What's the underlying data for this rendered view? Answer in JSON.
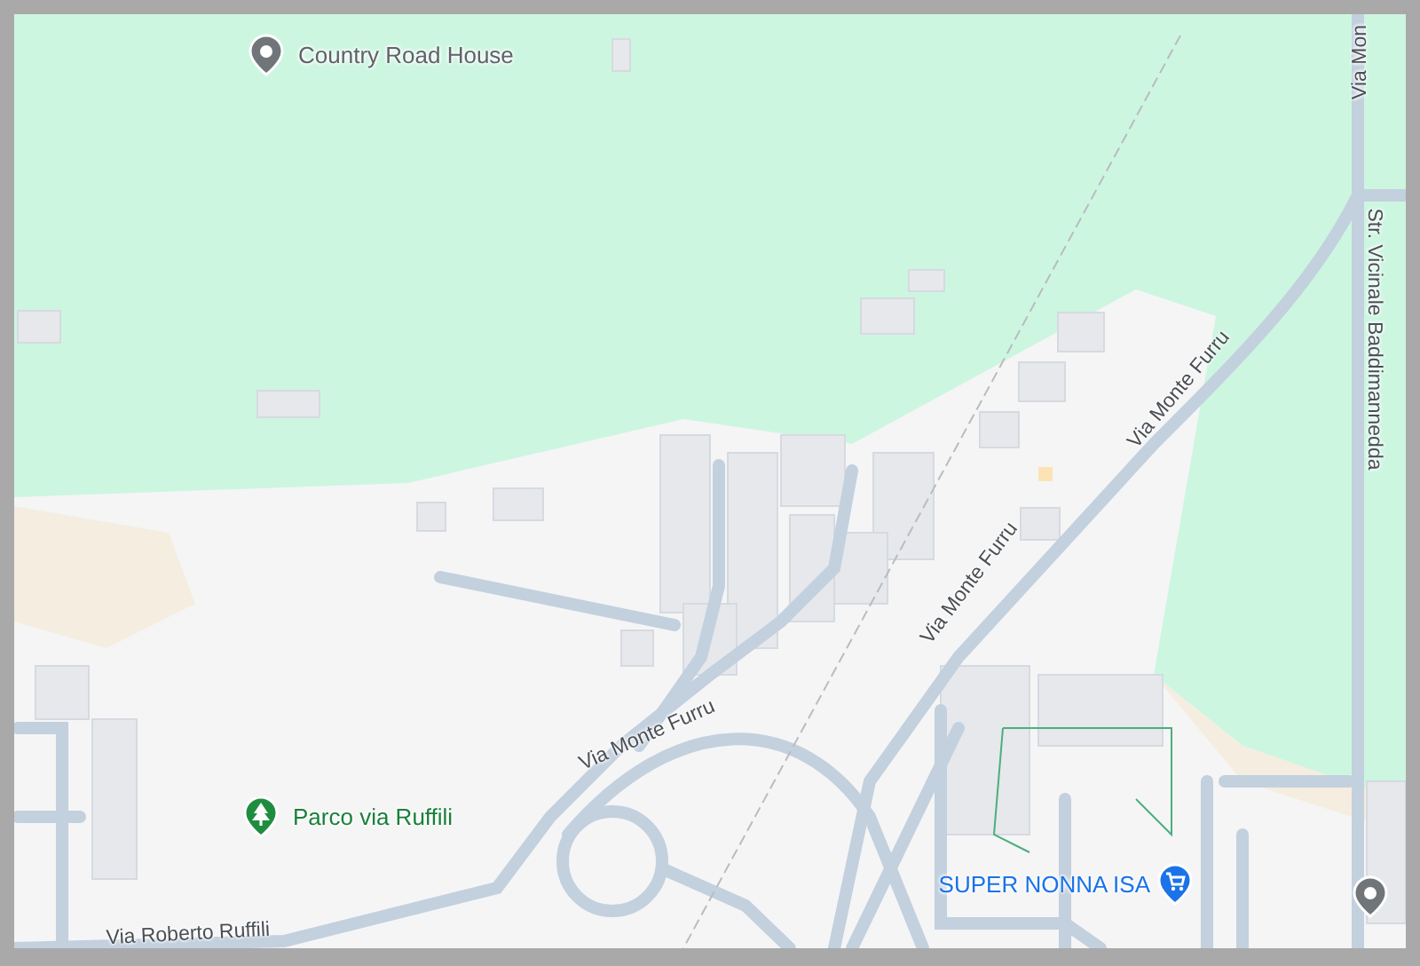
{
  "map": {
    "places": [
      {
        "name": "Country Road House",
        "kind": "poi"
      },
      {
        "name": "Parco via Ruffili",
        "kind": "park"
      },
      {
        "name": "SUPER NONNA ISA",
        "kind": "shop"
      }
    ],
    "roads": [
      {
        "name": "Via Mon"
      },
      {
        "name": "Str. Vicinale Baddimannedda"
      },
      {
        "name": "Via Monte Furru"
      },
      {
        "name": "Via Monte Furru"
      },
      {
        "name": "Via Monte Furru"
      },
      {
        "name": "Via Roberto Ruffili"
      }
    ]
  }
}
